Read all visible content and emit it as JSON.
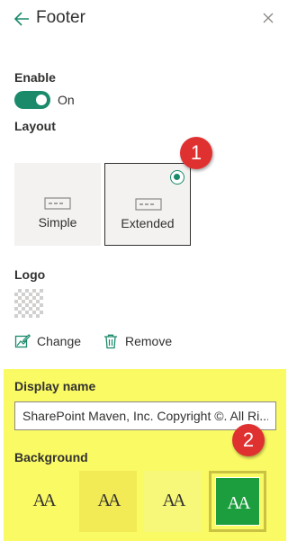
{
  "header": {
    "title": "Footer"
  },
  "enable": {
    "label": "Enable",
    "state_text": "On",
    "on": true
  },
  "layout": {
    "label": "Layout",
    "options": [
      {
        "label": "Simple",
        "selected": false
      },
      {
        "label": "Extended",
        "selected": true
      }
    ]
  },
  "callouts": [
    "1",
    "2"
  ],
  "logo": {
    "label": "Logo",
    "change_label": "Change",
    "remove_label": "Remove"
  },
  "display_name": {
    "label": "Display name",
    "value": "SharePoint Maven, Inc. Copyright ©. All Ri..."
  },
  "background": {
    "label": "Background",
    "swatch_text": "AA",
    "swatches": [
      {
        "color": "#fafa64",
        "selected": false
      },
      {
        "color": "#f2eb55",
        "selected": false
      },
      {
        "color": "#f7f87a",
        "selected": false
      },
      {
        "color": "#1c9e3e",
        "selected": true
      }
    ]
  },
  "colors": {
    "accent": "#1a8a6b",
    "callout": "#e03131",
    "highlight": "#fafa64"
  },
  "icons": [
    "back-arrow-icon",
    "close-icon",
    "layout-placeholder-icon",
    "radio-selected-icon",
    "edit-image-icon",
    "trash-icon"
  ]
}
